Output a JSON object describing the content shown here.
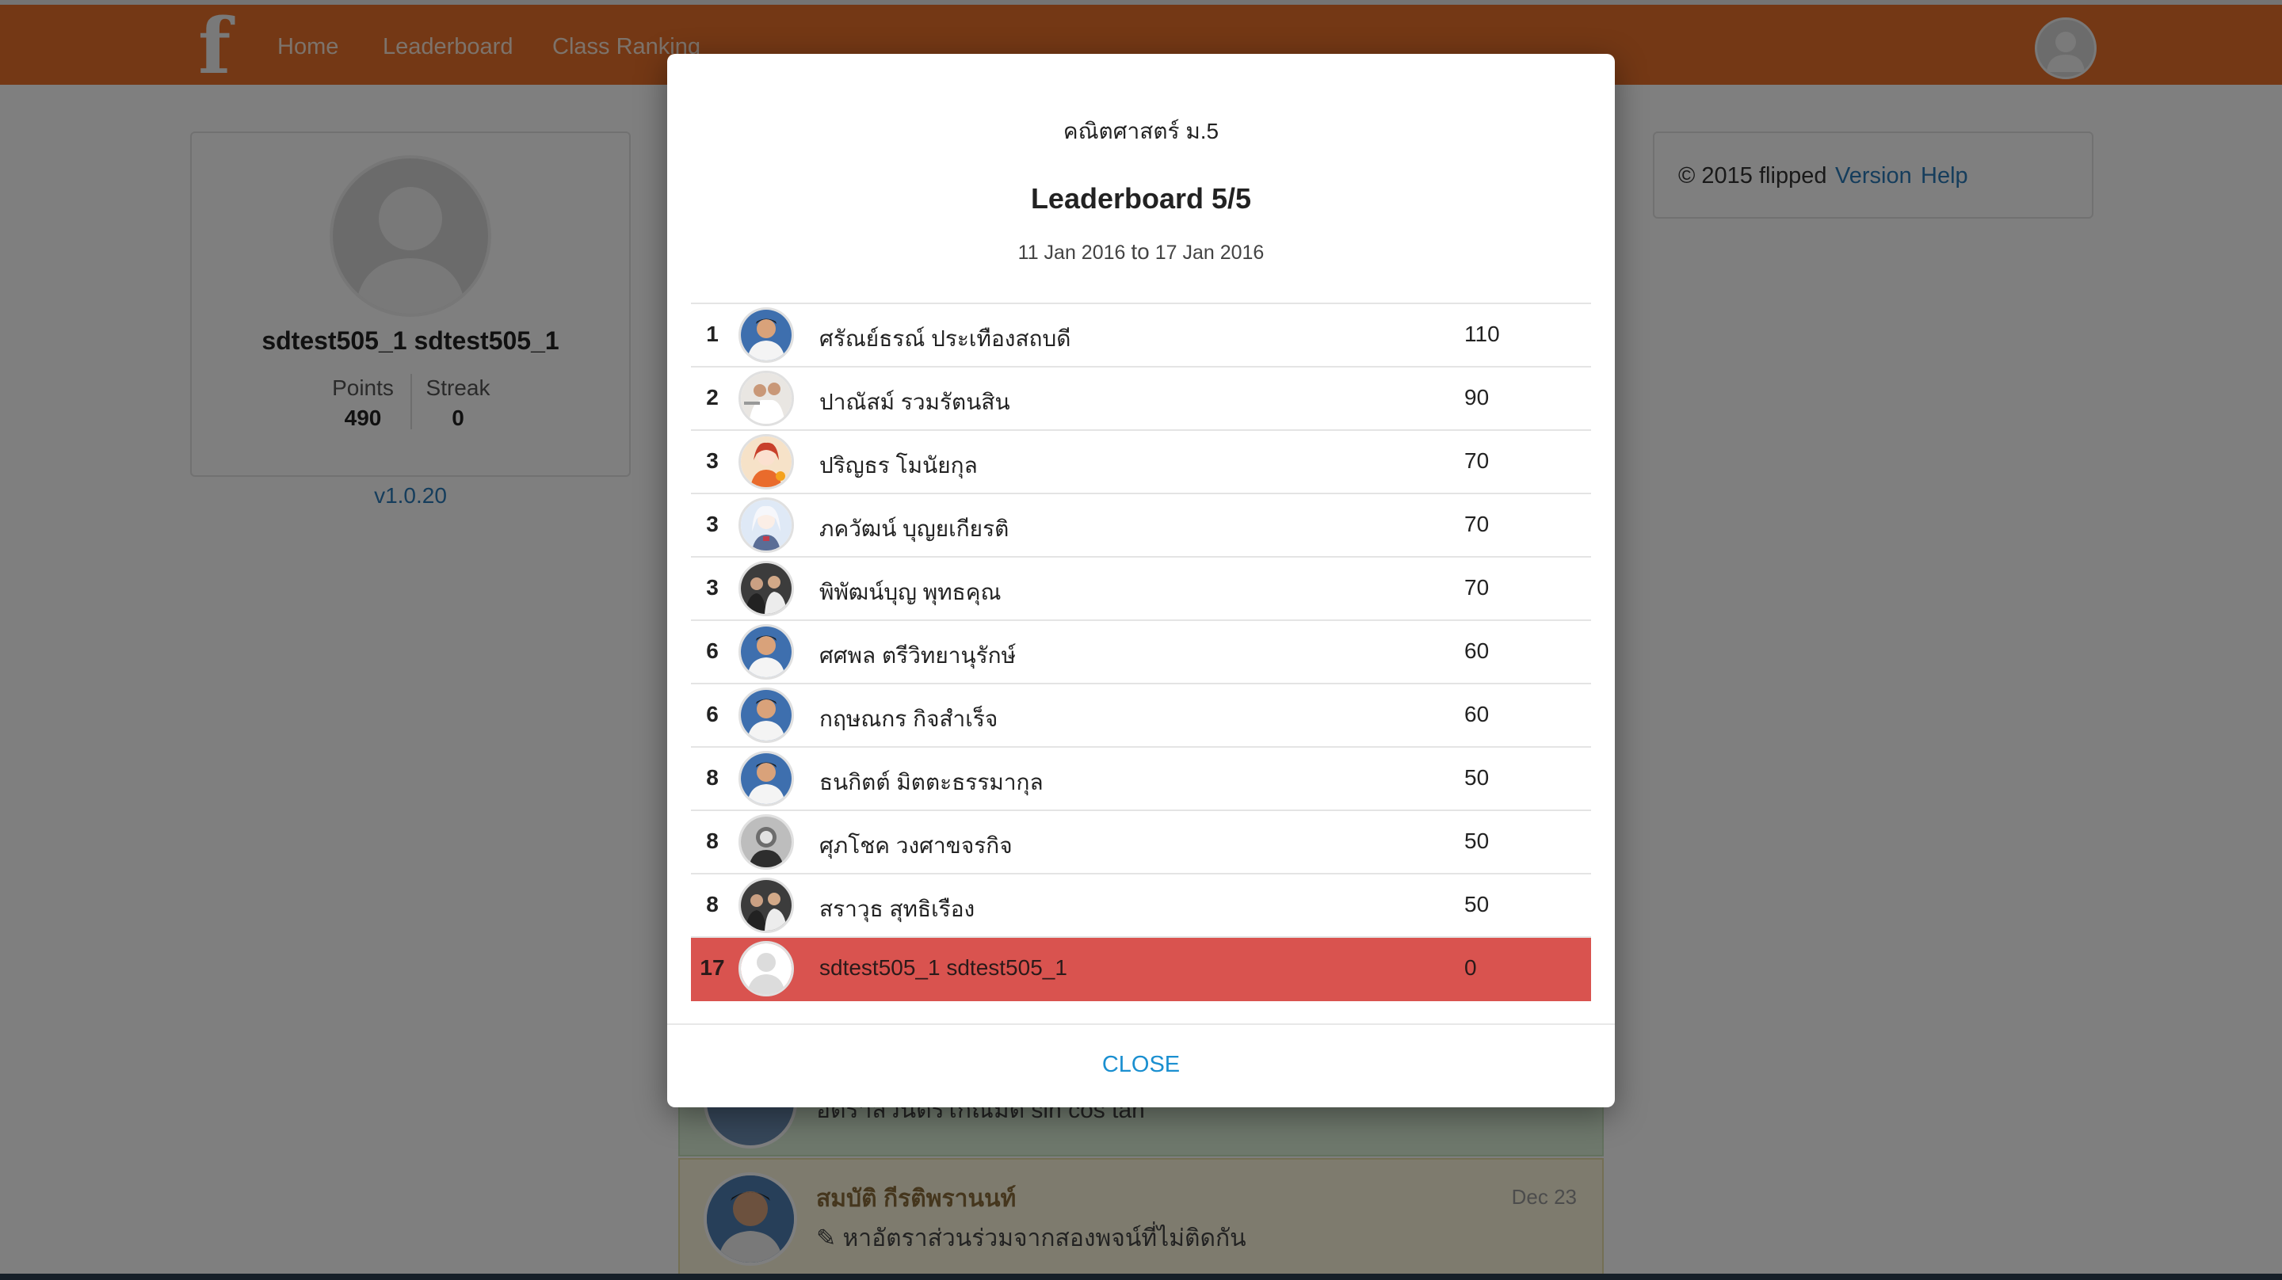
{
  "nav": {
    "logo": "f",
    "links": [
      "Home",
      "Leaderboard",
      "Class Ranking"
    ]
  },
  "profile": {
    "name": "sdtest505_1 sdtest505_1",
    "points_label": "Points",
    "points_value": "490",
    "streak_label": "Streak",
    "streak_value": "0",
    "version": "v1.0.20"
  },
  "footer": {
    "copyright": "© 2015 flipped",
    "version_link": "Version",
    "help_link": "Help"
  },
  "feed": [
    {
      "text": "อัตราส่วนตรีโกณมิติ sin cos tan"
    },
    {
      "author": "สมบัติ กีรติพรานนท์",
      "date": "Dec 23",
      "text": "หาอัตราส่วนร่วมจากสองพจน์ที่ไม่ติดกัน"
    }
  ],
  "modal": {
    "subject": "คณิตศาสตร์ ม.5",
    "title": "Leaderboard 5/5",
    "date_from": "11 Jan 2016",
    "date_to_word": "to",
    "date_to": "17 Jan 2016",
    "close_label": "CLOSE",
    "rows": [
      {
        "rank": "1",
        "name": "ศรัณย์ธรณ์ ประเทืองสถบดี",
        "points": "110",
        "avatar": "photo-student"
      },
      {
        "rank": "2",
        "name": "ปาณัสม์ รวมรัตนสิน",
        "points": "90",
        "avatar": "photo-sports"
      },
      {
        "rank": "3",
        "name": "ปริญธร โมนัยกุล",
        "points": "70",
        "avatar": "photo-anime-red"
      },
      {
        "rank": "3",
        "name": "ภควัฒน์ บุญยเกียรติ",
        "points": "70",
        "avatar": "photo-anime-white"
      },
      {
        "rank": "3",
        "name": "พิพัฒน์บุญ พุทธคุณ",
        "points": "70",
        "avatar": "photo-group"
      },
      {
        "rank": "6",
        "name": "ศศพล ตรีวิทยานุรักษ์",
        "points": "60",
        "avatar": "photo-student"
      },
      {
        "rank": "6",
        "name": "กฤษณกร กิจสำเร็จ",
        "points": "60",
        "avatar": "photo-student"
      },
      {
        "rank": "8",
        "name": "ธนกิตต์ มิตตะธรรมากุล",
        "points": "50",
        "avatar": "photo-student"
      },
      {
        "rank": "8",
        "name": "ศุภโชค วงศาขจรกิจ",
        "points": "50",
        "avatar": "photo-bw"
      },
      {
        "rank": "8",
        "name": "สราวุธ สุทธิเรือง",
        "points": "50",
        "avatar": "photo-group"
      },
      {
        "rank": "17",
        "name": "sdtest505_1 sdtest505_1",
        "points": "0",
        "avatar": "default-avatar",
        "current_user": true
      }
    ]
  },
  "colors": {
    "navbar": "#e8702a",
    "link": "#2a7ab8",
    "highlight_row": "#d9534f",
    "close": "#1a8fd0"
  }
}
